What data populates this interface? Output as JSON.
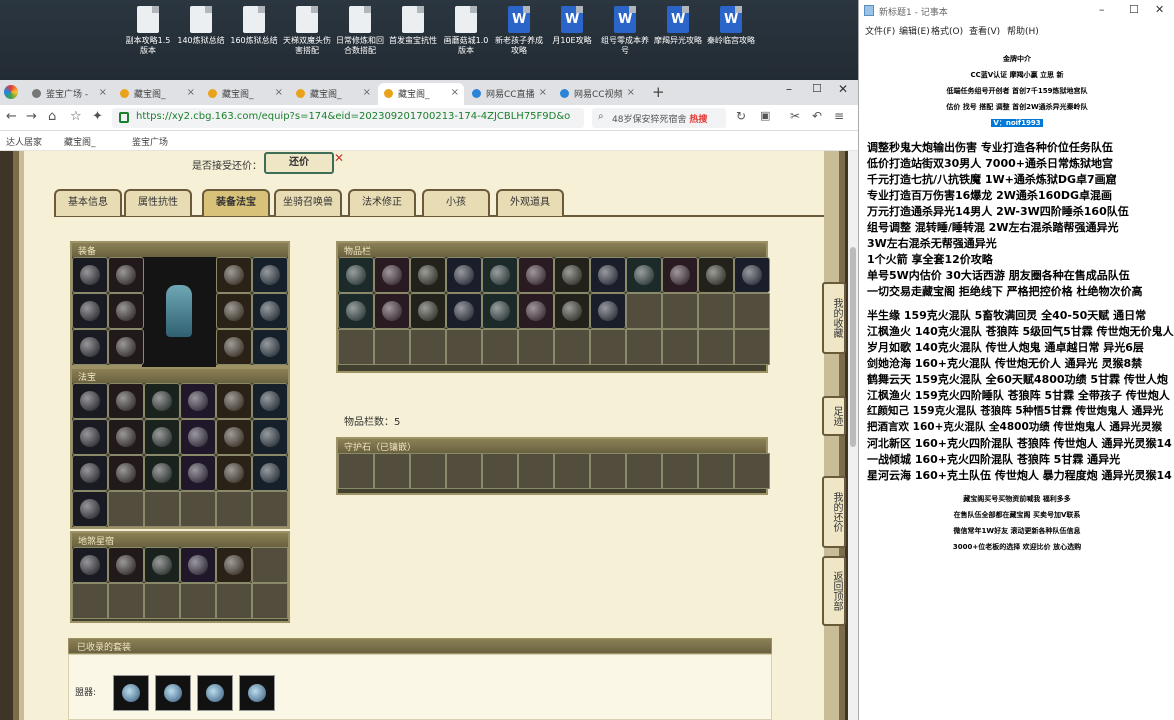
{
  "desktop": {
    "icons": [
      {
        "label": "副本攻略1.5版本",
        "type": "doc"
      },
      {
        "label": "140炼狱总结",
        "type": "doc"
      },
      {
        "label": "160炼狱总结",
        "type": "doc"
      },
      {
        "label": "天梯双魔头伤害搭配",
        "type": "doc"
      },
      {
        "label": "日常修炼和回合数搭配",
        "type": "doc"
      },
      {
        "label": "首发蛮宝抗性",
        "type": "doc"
      },
      {
        "label": "画蘑菇城1.0版本",
        "type": "doc"
      },
      {
        "label": "新老孩子养成攻略",
        "type": "word"
      },
      {
        "label": "月10E攻略",
        "type": "word"
      },
      {
        "label": "组号零成本养号",
        "type": "word"
      },
      {
        "label": "摩羯异光攻略",
        "type": "word"
      },
      {
        "label": "秦岭临宫攻略",
        "type": "word"
      }
    ]
  },
  "browser": {
    "tabs": [
      {
        "label": "鉴宝广场 -"
      },
      {
        "label": "藏宝阁_"
      },
      {
        "label": "藏宝阁_"
      },
      {
        "label": "藏宝阁_"
      },
      {
        "label": "藏宝阁_"
      },
      {
        "label": "网易CC直播"
      },
      {
        "label": "网易CC视频"
      }
    ],
    "url": "https://xy2.cbg.163.com/equip?s=174&eid=202309201700213-174-4ZJCBLH75F9D&o",
    "search_text": "48岁保安猝死宿舍",
    "search_hot": "热搜",
    "bookmarks": [
      "达人居家",
      "藏宝阁_",
      "鉴宝广场"
    ]
  },
  "page": {
    "offer_label": "是否接受还价：",
    "offer_button": "还价",
    "tabs": [
      "基本信息",
      "属性抗性",
      "装备法宝",
      "坐骑召唤兽",
      "法术修正",
      "小孩",
      "外观道具"
    ],
    "active_tab": "装备法宝",
    "panels": {
      "equipment": "装备",
      "fabao": "法宝",
      "souls": "地煞星宿",
      "inventory": "物品栏",
      "inventory_count": "物品栏数：5",
      "guard_stone": "守护石（已镶嵌）",
      "collected_sets": "已收录的套装",
      "collected_label": "盟器:"
    },
    "side_buttons": [
      "我的收藏",
      "足迹",
      "我的还价",
      "返回顶部"
    ]
  },
  "notepad": {
    "title": "新标题1 - 记事本",
    "menu": [
      "文件(F)",
      "编辑(E)",
      "格式(O)",
      "查看(V)",
      "帮助(H)"
    ],
    "lines": [
      {
        "text": "金牌中介",
        "center": true
      },
      {
        "text": "CC蓝V认证  摩羯小赢  立思  新",
        "center": true
      },
      {
        "text": "低端任务组号开创者      首创7千159炼狱地宫队",
        "center": true
      },
      {
        "text": "估价 找号 搭配 调整      首创2W通杀异光秦岭队",
        "center": true
      },
      {
        "text": "V：noif1993",
        "center": true,
        "highlight": true
      },
      {
        "text": "",
        "center": false
      },
      {
        "text": "调整秒鬼大炮输出伤害           专业打造各种价位任务队伍",
        "center": false
      },
      {
        "text": "低价打造站街双30男人             7000+通杀日常炼狱地宫",
        "center": false
      },
      {
        "text": "千元打造七抗/八抗铁魔            1W+通杀炼狱DG卓7画窟",
        "center": false
      },
      {
        "text": "专业打造百万伤害16爆龙          2W通杀160DG卓混画",
        "center": false
      },
      {
        "text": "万元打造通杀异光14男人        2W-3W四阶睡杀160队伍",
        "center": false
      },
      {
        "text": "组号调整 混转睡/睡转混         2W左右混杀踏帮强通异光",
        "center": false
      },
      {
        "text": "                                                3W左右混杀无帮强通异光",
        "center": false
      },
      {
        "text": "1个火箭 享全套12价攻略",
        "center": false
      },
      {
        "text": "单号5W内估价 30大话西游        朋友圈各种在售成品队伍",
        "center": false
      },
      {
        "text": "一切交易走藏宝阁 拒绝线下     严格把控价格 杜绝物次价高",
        "center": false
      },
      {
        "text": "",
        "center": false
      },
      {
        "text": "半生缘    159克火混队 5畜牧满回灵 全40-50天赋 通日常",
        "center": false
      },
      {
        "text": "江枫渔火 140克火混队 苍狼阵 5级回气5甘霖 传世炮无价鬼人",
        "center": false
      },
      {
        "text": "岁月如歌 140克火混队 传世人炮鬼 通卓越日常 异光6层",
        "center": false
      },
      {
        "text": "剑她沧海 160+克火混队 传世炮无价人 通异光 灵猴8禁",
        "center": false
      },
      {
        "text": "鹤舞云天 159克火混队 全60天赋4800功绩 5甘霖 传世人炮",
        "center": false
      },
      {
        "text": "江枫渔火 159克火四阶睡队 苍狼阵 5甘霖 全带孩子 传世炮人",
        "center": false
      },
      {
        "text": "红颜知己 159克火混队 苍狼阵 5种悟5甘霖 传世炮鬼人 通异光",
        "center": false
      },
      {
        "text": "把酒言欢 160+克火混队 全4800功绩 传世炮鬼人 通异光灵猴",
        "center": false
      },
      {
        "text": "河北新区 160+克火四阶混队 苍狼阵 传世炮人 通异光灵猴14",
        "center": false
      },
      {
        "text": "一战倾城 160+克火四阶混队 苍狼阵 5甘霖 通异光",
        "center": false
      },
      {
        "text": "星河云海 160+克土队伍 传世炮人 暴力程度炮 通异光灵猴14",
        "center": false
      },
      {
        "text": "",
        "center": false
      },
      {
        "text": "藏宝阁买号买物资前喊我 福利多多",
        "center": true
      },
      {
        "text": "在售队伍全部都在藏宝阁 买卖号加V联系",
        "center": true
      },
      {
        "text": "微信常年1W好友 滚动更新各种队伍信息",
        "center": true
      },
      {
        "text": "3000+位老板的选择 欢迎比价 放心选购",
        "center": true
      }
    ]
  }
}
